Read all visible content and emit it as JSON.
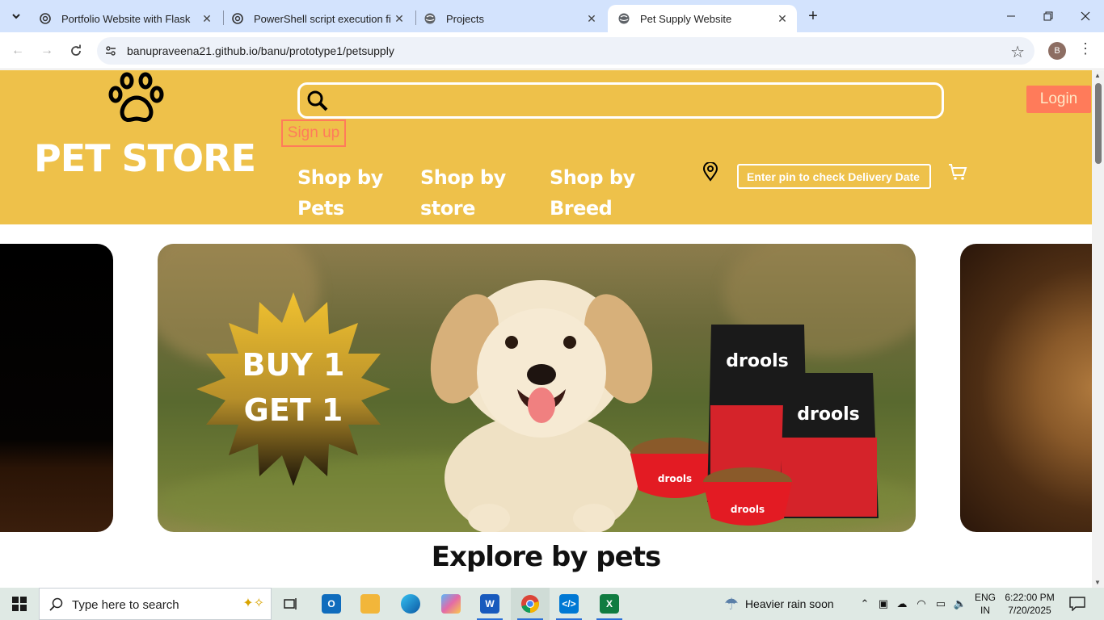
{
  "browser": {
    "tabs": [
      {
        "title": "Portfolio Website with Flask",
        "icon": "chatgpt-icon",
        "active": false
      },
      {
        "title": "PowerShell script execution fix",
        "icon": "chatgpt-icon",
        "active": false
      },
      {
        "title": "Projects",
        "icon": "globe-icon",
        "active": false
      },
      {
        "title": "Pet Supply Website",
        "icon": "globe-icon",
        "active": true
      }
    ],
    "url": "banupraveena21.github.io/banu/prototype1/petsupply",
    "profile_initial": "B"
  },
  "site": {
    "brand": "PET STORE",
    "search_placeholder": "",
    "signup_label": "Sign up",
    "login_label": "Login",
    "nav": [
      {
        "line1": "Shop by",
        "line2": "Pets"
      },
      {
        "line1": "Shop by",
        "line2": "store"
      },
      {
        "line1": "Shop by",
        "line2": "Breed"
      }
    ],
    "pin_placeholder": "Enter pin to check Delivery Date",
    "banner": {
      "offer_line1": "BUY 1",
      "offer_line2": "GET 1",
      "product_brand": "drools"
    },
    "section_title": "Explore by pets",
    "colors": {
      "header": "#eec14a",
      "accent": "#ff7b5a"
    }
  },
  "taskbar": {
    "search_text": "Type here to search",
    "weather": "Heavier rain soon",
    "lang_line1": "ENG",
    "lang_line2": "IN",
    "time": "6:22:00 PM",
    "date": "7/20/2025"
  }
}
